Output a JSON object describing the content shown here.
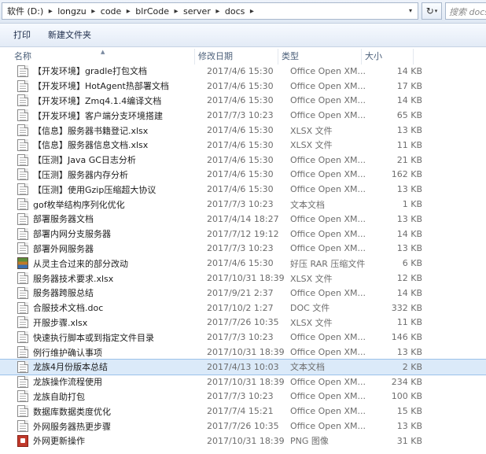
{
  "address": {
    "crumbs": [
      "软件 (D:)",
      "longzu",
      "code",
      "blrCode",
      "server",
      "docs"
    ],
    "search_placeholder": "搜索 docs"
  },
  "toolbar": {
    "print_label": "打印",
    "new_folder_label": "新建文件夹"
  },
  "columns": {
    "name": "名称",
    "date": "修改日期",
    "type": "类型",
    "size": "大小"
  },
  "files": [
    {
      "name": "【开发环境】gradle打包文档",
      "date": "2017/4/6 15:30",
      "type": "Office Open XM...",
      "size": "14 KB",
      "icon": "document-icon"
    },
    {
      "name": "【开发环境】HotAgent热部署文档",
      "date": "2017/4/6 15:30",
      "type": "Office Open XM...",
      "size": "17 KB",
      "icon": "document-icon"
    },
    {
      "name": "【开发环境】Zmq4.1.4编译文档",
      "date": "2017/4/6 15:30",
      "type": "Office Open XM...",
      "size": "14 KB",
      "icon": "document-icon"
    },
    {
      "name": "【开发环境】客户端分支环境搭建",
      "date": "2017/7/3 10:23",
      "type": "Office Open XM...",
      "size": "65 KB",
      "icon": "document-icon"
    },
    {
      "name": "【信息】服务器书籍登记.xlsx",
      "date": "2017/4/6 15:30",
      "type": "XLSX 文件",
      "size": "13 KB",
      "icon": "document-icon"
    },
    {
      "name": "【信息】服务器信息文档.xlsx",
      "date": "2017/4/6 15:30",
      "type": "XLSX 文件",
      "size": "11 KB",
      "icon": "document-icon"
    },
    {
      "name": "【压测】Java GC日志分析",
      "date": "2017/4/6 15:30",
      "type": "Office Open XM...",
      "size": "21 KB",
      "icon": "document-icon"
    },
    {
      "name": "【压测】服务器内存分析",
      "date": "2017/4/6 15:30",
      "type": "Office Open XM...",
      "size": "162 KB",
      "icon": "document-icon"
    },
    {
      "name": "【压测】使用Gzip压缩超大协议",
      "date": "2017/4/6 15:30",
      "type": "Office Open XM...",
      "size": "13 KB",
      "icon": "document-icon"
    },
    {
      "name": "gof枚举结构序列化优化",
      "date": "2017/7/3 10:23",
      "type": "文本文档",
      "size": "1 KB",
      "icon": "document-icon"
    },
    {
      "name": "部署服务器文档",
      "date": "2017/4/14 18:27",
      "type": "Office Open XM...",
      "size": "13 KB",
      "icon": "document-icon"
    },
    {
      "name": "部署内网分支服务器",
      "date": "2017/7/12 19:12",
      "type": "Office Open XM...",
      "size": "14 KB",
      "icon": "document-icon"
    },
    {
      "name": "部署外网服务器",
      "date": "2017/7/3 10:23",
      "type": "Office Open XM...",
      "size": "13 KB",
      "icon": "document-icon"
    },
    {
      "name": "从灵主合过来的部分改动",
      "date": "2017/4/6 15:30",
      "type": "好压 RAR 压缩文件",
      "size": "6 KB",
      "icon": "rar-archive-icon"
    },
    {
      "name": "服务器技术要求.xlsx",
      "date": "2017/10/31 18:39",
      "type": "XLSX 文件",
      "size": "12 KB",
      "icon": "document-icon"
    },
    {
      "name": "服务器跨服总结",
      "date": "2017/9/21 2:37",
      "type": "Office Open XM...",
      "size": "14 KB",
      "icon": "document-icon"
    },
    {
      "name": "合服技术文档.doc",
      "date": "2017/10/2 1:27",
      "type": "DOC 文件",
      "size": "332 KB",
      "icon": "document-icon"
    },
    {
      "name": "开服步骤.xlsx",
      "date": "2017/7/26 10:35",
      "type": "XLSX 文件",
      "size": "11 KB",
      "icon": "document-icon"
    },
    {
      "name": "快速执行脚本或到指定文件目录",
      "date": "2017/7/3 10:23",
      "type": "Office Open XM...",
      "size": "146 KB",
      "icon": "document-icon"
    },
    {
      "name": "例行维护确认事项",
      "date": "2017/10/31 18:39",
      "type": "Office Open XM...",
      "size": "13 KB",
      "icon": "document-icon"
    },
    {
      "name": "龙族4月份版本总结",
      "date": "2017/4/13 10:03",
      "type": "文本文档",
      "size": "2 KB",
      "icon": "document-icon",
      "selected": true
    },
    {
      "name": "龙族操作流程使用",
      "date": "2017/10/31 18:39",
      "type": "Office Open XM...",
      "size": "234 KB",
      "icon": "document-icon"
    },
    {
      "name": "龙族自助打包",
      "date": "2017/7/3 10:23",
      "type": "Office Open XM...",
      "size": "100 KB",
      "icon": "document-icon"
    },
    {
      "name": "数据库数据类度优化",
      "date": "2017/7/4 15:21",
      "type": "Office Open XM...",
      "size": "15 KB",
      "icon": "document-icon"
    },
    {
      "name": "外网服务器热更步骤",
      "date": "2017/7/26 10:35",
      "type": "Office Open XM...",
      "size": "13 KB",
      "icon": "document-icon"
    },
    {
      "name": "外网更新操作",
      "date": "2017/10/31 18:39",
      "type": "PNG 图像",
      "size": "31 KB",
      "icon": "png-image-icon"
    }
  ]
}
